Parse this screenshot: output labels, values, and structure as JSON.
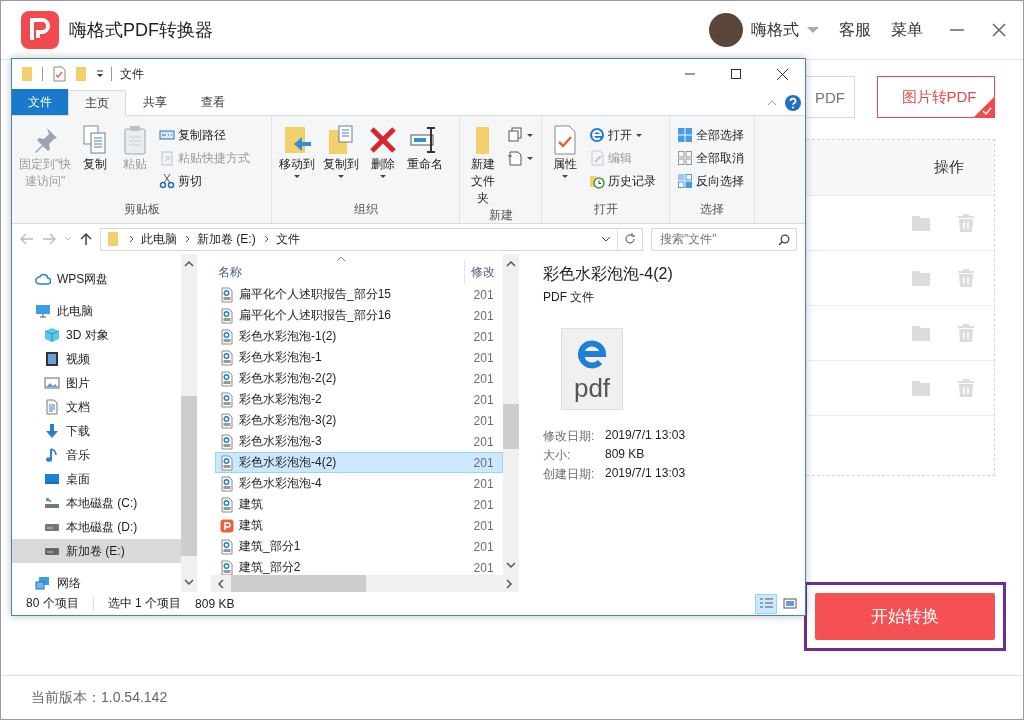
{
  "app": {
    "title": "嗨格式PDF转换器",
    "user": "嗨格式",
    "menu": [
      "客服",
      "菜单"
    ],
    "modes": [
      {
        "label": "PDF",
        "selected": false
      },
      {
        "label": "图片转PDF",
        "selected": true
      }
    ],
    "table": {
      "action_header": "操作",
      "rows": [
        {
          "disabled": true
        },
        {
          "disabled": true
        },
        {
          "disabled": true
        },
        {
          "disabled": true
        }
      ]
    },
    "start_button": "开始转换",
    "version": "当前版本：1.0.54.142"
  },
  "explorer": {
    "title": "文件",
    "ribbon_tabs": [
      {
        "label": "文件",
        "kind": "file",
        "selected": false
      },
      {
        "label": "主页",
        "kind": "tab",
        "selected": true
      },
      {
        "label": "共享",
        "kind": "tab",
        "selected": false
      },
      {
        "label": "查看",
        "kind": "tab",
        "selected": false
      }
    ],
    "groups": [
      {
        "label": "剪贴板",
        "items": [
          {
            "label": [
              "固定到\"快",
              "速访问\""
            ],
            "kind": "large",
            "disabled": true,
            "dropdown": false
          },
          {
            "label": [
              "复制"
            ],
            "kind": "large",
            "disabled": false,
            "dropdown": false
          },
          {
            "label": [
              "粘贴"
            ],
            "kind": "large",
            "disabled": true,
            "dropdown": false
          },
          {
            "label": "复制路径",
            "kind": "small",
            "disabled": false,
            "dropdown": false
          },
          {
            "label": "粘贴快捷方式",
            "kind": "small",
            "disabled": true,
            "dropdown": false
          },
          {
            "label": "剪切",
            "kind": "small",
            "disabled": false,
            "dropdown": false
          }
        ]
      },
      {
        "label": "组织",
        "items": [
          {
            "label": [
              "移动到"
            ],
            "kind": "large",
            "disabled": false,
            "dropdown": true
          },
          {
            "label": [
              "复制到"
            ],
            "kind": "large",
            "disabled": false,
            "dropdown": true
          },
          {
            "label": [
              "删除"
            ],
            "kind": "large",
            "disabled": false,
            "dropdown": true
          },
          {
            "label": [
              "重命名"
            ],
            "kind": "large",
            "disabled": false,
            "dropdown": false
          }
        ]
      },
      {
        "label": "新建",
        "items": [
          {
            "label": [
              "新建",
              "文件夹"
            ],
            "kind": "large",
            "disabled": false,
            "dropdown": false
          },
          {
            "kind": "icon",
            "disabled": false,
            "dropdown": true
          },
          {
            "kind": "icon",
            "disabled": false,
            "dropdown": true
          }
        ]
      },
      {
        "label": "打开",
        "items": [
          {
            "label": [
              "属性"
            ],
            "kind": "large",
            "disabled": false,
            "dropdown": true
          },
          {
            "label": "打开",
            "kind": "small",
            "disabled": false,
            "dropdown": true
          },
          {
            "label": "编辑",
            "kind": "small",
            "disabled": true,
            "dropdown": false
          },
          {
            "label": "历史记录",
            "kind": "small",
            "disabled": false,
            "dropdown": false
          }
        ]
      },
      {
        "label": "选择",
        "items": [
          {
            "label": "全部选择",
            "kind": "small",
            "disabled": false,
            "dropdown": false
          },
          {
            "label": "全部取消",
            "kind": "small",
            "disabled": false,
            "dropdown": false
          },
          {
            "label": "反向选择",
            "kind": "small",
            "disabled": false,
            "dropdown": false
          }
        ]
      }
    ],
    "breadcrumbs": [
      "此电脑",
      "新加卷 (E:)",
      "文件"
    ],
    "search": {
      "placeholder": "搜索\"文件\""
    },
    "nav": [
      {
        "label": "WPS网盘",
        "selected": false
      },
      {
        "label": "此电脑",
        "selected": false,
        "children": [
          {
            "label": "3D 对象",
            "selected": false
          },
          {
            "label": "视频",
            "selected": false
          },
          {
            "label": "图片",
            "selected": false
          },
          {
            "label": "文档",
            "selected": false
          },
          {
            "label": "下载",
            "selected": false
          },
          {
            "label": "音乐",
            "selected": false
          },
          {
            "label": "桌面",
            "selected": false
          },
          {
            "label": "本地磁盘 (C:)",
            "selected": false
          },
          {
            "label": "本地磁盘 (D:)",
            "selected": false
          },
          {
            "label": "新加卷 (E:)",
            "selected": true
          }
        ]
      },
      {
        "label": "网络",
        "selected": false
      }
    ],
    "columns": [
      "名称",
      "修改"
    ],
    "files": [
      {
        "name": "扁平化个人述职报告_部分15",
        "date": "201",
        "kind": "pdf",
        "selected": false
      },
      {
        "name": "扁平化个人述职报告_部分16",
        "date": "201",
        "kind": "pdf",
        "selected": false
      },
      {
        "name": "彩色水彩泡泡-1(2)",
        "date": "201",
        "kind": "pdf",
        "selected": false
      },
      {
        "name": "彩色水彩泡泡-1",
        "date": "201",
        "kind": "pdf",
        "selected": false
      },
      {
        "name": "彩色水彩泡泡-2(2)",
        "date": "201",
        "kind": "pdf",
        "selected": false
      },
      {
        "name": "彩色水彩泡泡-2",
        "date": "201",
        "kind": "pdf",
        "selected": false
      },
      {
        "name": "彩色水彩泡泡-3(2)",
        "date": "201",
        "kind": "pdf",
        "selected": false
      },
      {
        "name": "彩色水彩泡泡-3",
        "date": "201",
        "kind": "pdf",
        "selected": false
      },
      {
        "name": "彩色水彩泡泡-4(2)",
        "date": "201",
        "kind": "pdf",
        "selected": true
      },
      {
        "name": "彩色水彩泡泡-4",
        "date": "201",
        "kind": "pdf",
        "selected": false
      },
      {
        "name": "建筑",
        "date": "201",
        "kind": "pdf",
        "selected": false
      },
      {
        "name": "建筑",
        "date": "201",
        "kind": "slides",
        "selected": false
      },
      {
        "name": "建筑_部分1",
        "date": "201",
        "kind": "pdf",
        "selected": false
      },
      {
        "name": "建筑_部分2",
        "date": "201",
        "kind": "pdf",
        "selected": false
      }
    ],
    "preview": {
      "name": "彩色水彩泡泡-4(2)",
      "type": "PDF 文件",
      "icon_label": "pdf",
      "properties": [
        {
          "label": "修改日期:",
          "value": "2019/7/1 13:03"
        },
        {
          "label": "大小:",
          "value": "809 KB"
        },
        {
          "label": "创建日期:",
          "value": "2019/7/1 13:03"
        }
      ]
    },
    "status": {
      "count": "80 个项目",
      "selection": "选中 1 个项目",
      "size": "809 KB"
    },
    "views": [
      {
        "selected": true
      },
      {
        "selected": false
      }
    ]
  }
}
